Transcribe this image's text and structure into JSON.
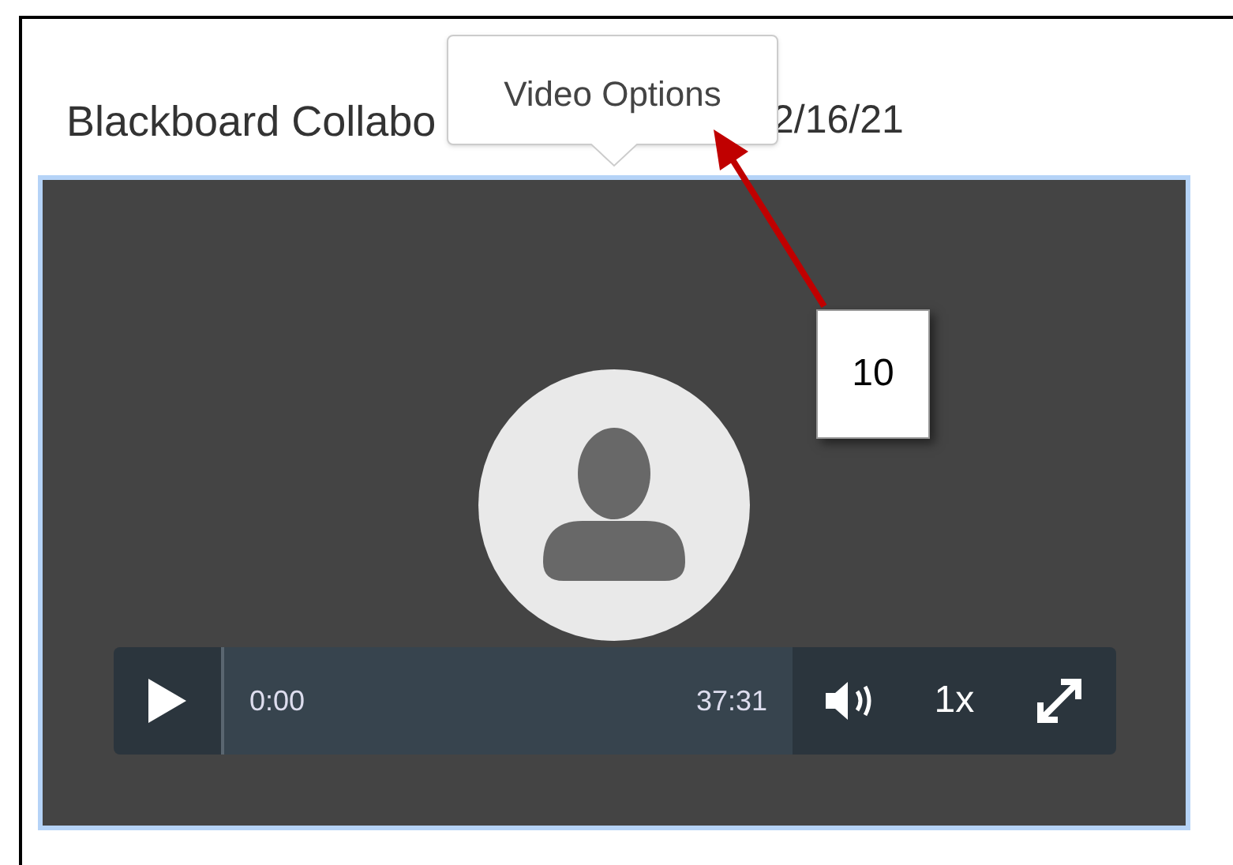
{
  "heading": {
    "visible_start": "Blackboard Collabo",
    "visible_end": "2/16/21"
  },
  "tooltip": {
    "text": "Video Options"
  },
  "player": {
    "current_time": "0:00",
    "duration": "37:31",
    "speed": "1x",
    "level": 0
  },
  "annotation": {
    "number": "10"
  }
}
